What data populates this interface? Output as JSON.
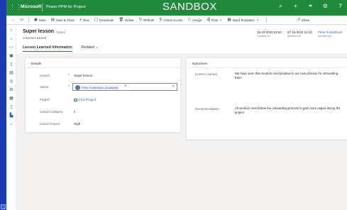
{
  "topbar": {
    "brand": "Microsoft",
    "app_name": "Power PPM for Project",
    "environment": "SANDBOX",
    "icons": [
      "search-icon",
      "add-icon",
      "filter-icon",
      "settings-icon",
      "help-icon"
    ]
  },
  "commands": [
    {
      "icon": "back-icon",
      "label": ""
    },
    {
      "icon": "popout-icon",
      "label": ""
    },
    {
      "icon": "save-icon",
      "label": "Save"
    },
    {
      "icon": "save-close-icon",
      "label": "Save & Close"
    },
    {
      "icon": "new-icon",
      "label": "New"
    },
    {
      "icon": "deactivate-icon",
      "label": "Deactivate"
    },
    {
      "icon": "delete-icon",
      "label": "Delete"
    },
    {
      "icon": "refresh-icon",
      "label": "Refresh"
    },
    {
      "icon": "check-access-icon",
      "label": "Check Access"
    },
    {
      "icon": "assign-icon",
      "label": "Assign"
    },
    {
      "icon": "flow-icon",
      "label": "Flow"
    },
    {
      "icon": "word-templates-icon",
      "label": "Word Templates"
    },
    {
      "icon": "share-icon",
      "label": "Share"
    }
  ],
  "record": {
    "title": "Super lesson",
    "status": "- Saved",
    "entity": "Lessons Learned",
    "created_on": {
      "value": "18-10-2022 23:54",
      "label": "Created On"
    },
    "modified_on": {
      "value": "27-10-2022 14:10",
      "label": "Modified On"
    },
    "modified_by": {
      "value": "Peter Kosterlitsch",
      "label": "Modified By"
    }
  },
  "tabs": [
    {
      "label": "Lesson Learned Information",
      "active": true
    },
    {
      "label": "Related",
      "active": false
    }
  ],
  "details": {
    "title": "Details",
    "fields": [
      {
        "label": "Lesson",
        "required": "*",
        "value": "Super lesson"
      },
      {
        "label": "Author",
        "required": "*",
        "value": "Peter Kosterlitsch (Available)"
      },
      {
        "label": "Project",
        "required": "",
        "value": "First Project"
      },
      {
        "label": "Lesson Category",
        "required": "",
        "value": "it"
      },
      {
        "label": "Lesson Impact",
        "required": "",
        "value": "High"
      }
    ]
  },
  "narratives": {
    "title": "Narratives",
    "fields": [
      {
        "label": "Lesson Learned",
        "value": "We have seen that vendors react positive to our new process for onboarding them"
      },
      {
        "label": "Recommendation",
        "value": "All vendors must follow the onboarding process to gain more output during the project"
      }
    ]
  }
}
